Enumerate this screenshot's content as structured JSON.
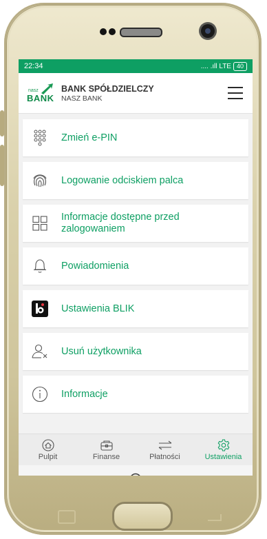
{
  "status_bar": {
    "time": "22:34",
    "signal": ".... .ıll LTE",
    "battery": "40"
  },
  "header": {
    "logo_small": "nasz",
    "logo_big": "BANK",
    "title": "BANK SPÓŁDZIELCZY",
    "subtitle": "NASZ BANK"
  },
  "menu": [
    {
      "label": "Zmień e-PIN",
      "icon": "keypad-icon"
    },
    {
      "label": "Logowanie odciskiem palca",
      "icon": "fingerprint-icon"
    },
    {
      "label": "Informacje dostępne przed zalogowaniem",
      "icon": "grid-icon"
    },
    {
      "label": "Powiadomienia",
      "icon": "bell-icon"
    },
    {
      "label": "Ustawienia BLIK",
      "icon": "blik-icon"
    },
    {
      "label": "Usuń użytkownika",
      "icon": "remove-user-icon"
    },
    {
      "label": "Informacje",
      "icon": "info-icon"
    }
  ],
  "bottom_nav": [
    {
      "label": "Pulpit",
      "icon": "home-icon"
    },
    {
      "label": "Finanse",
      "icon": "wallet-icon"
    },
    {
      "label": "Płatności",
      "icon": "transfer-icon"
    },
    {
      "label": "Ustawienia",
      "icon": "gear-icon",
      "active": true
    }
  ],
  "colors": {
    "accent": "#0e9f63",
    "status_bar": "#0e9f63"
  }
}
